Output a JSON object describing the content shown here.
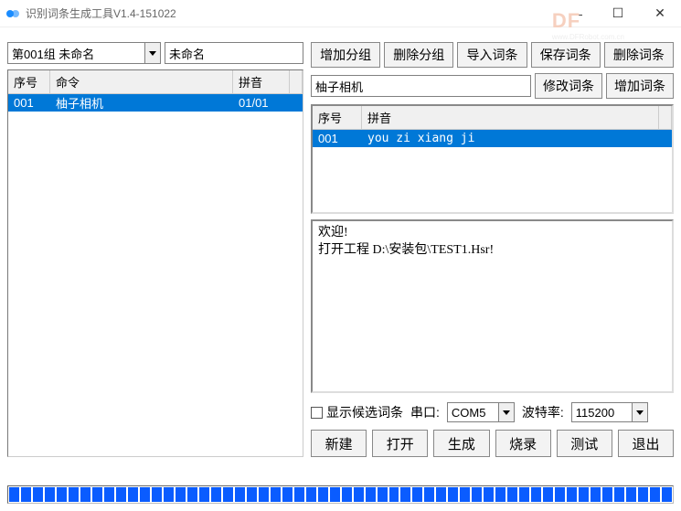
{
  "window": {
    "title": "识别词条生成工具V1.4-151022"
  },
  "watermark": {
    "big": "DF",
    "small": "www.DFRobot.com.cn"
  },
  "left": {
    "group_combo": "第001组 未命名",
    "group_name": "未命名",
    "columns": {
      "seq": "序号",
      "cmd": "命令",
      "pinyin": "拼音"
    },
    "rows": [
      {
        "seq": "001",
        "cmd": "柚子相机",
        "pinyin": "01/01"
      }
    ]
  },
  "right": {
    "btns": {
      "add_group": "增加分组",
      "del_group": "删除分组",
      "import": "导入词条",
      "save": "保存词条",
      "delete": "删除词条",
      "modify": "修改词条",
      "add_entry": "增加词条"
    },
    "entry_text": "柚子相机",
    "pinyin_cols": {
      "seq": "序号",
      "pinyin": "拼音"
    },
    "pinyin_rows": [
      {
        "seq": "001",
        "pinyin": "you zi xiang ji"
      }
    ],
    "log": "欢迎!\n打开工程 D:\\安装包\\TEST1.Hsr!",
    "opts": {
      "show_cand": "显示候选词条",
      "port_label": "串口:",
      "port_value": "COM5",
      "baud_label": "波特率:",
      "baud_value": "115200"
    },
    "bottom": {
      "new": "新建",
      "open": "打开",
      "gen": "生成",
      "burn": "烧录",
      "test": "测试",
      "exit": "退出"
    }
  }
}
